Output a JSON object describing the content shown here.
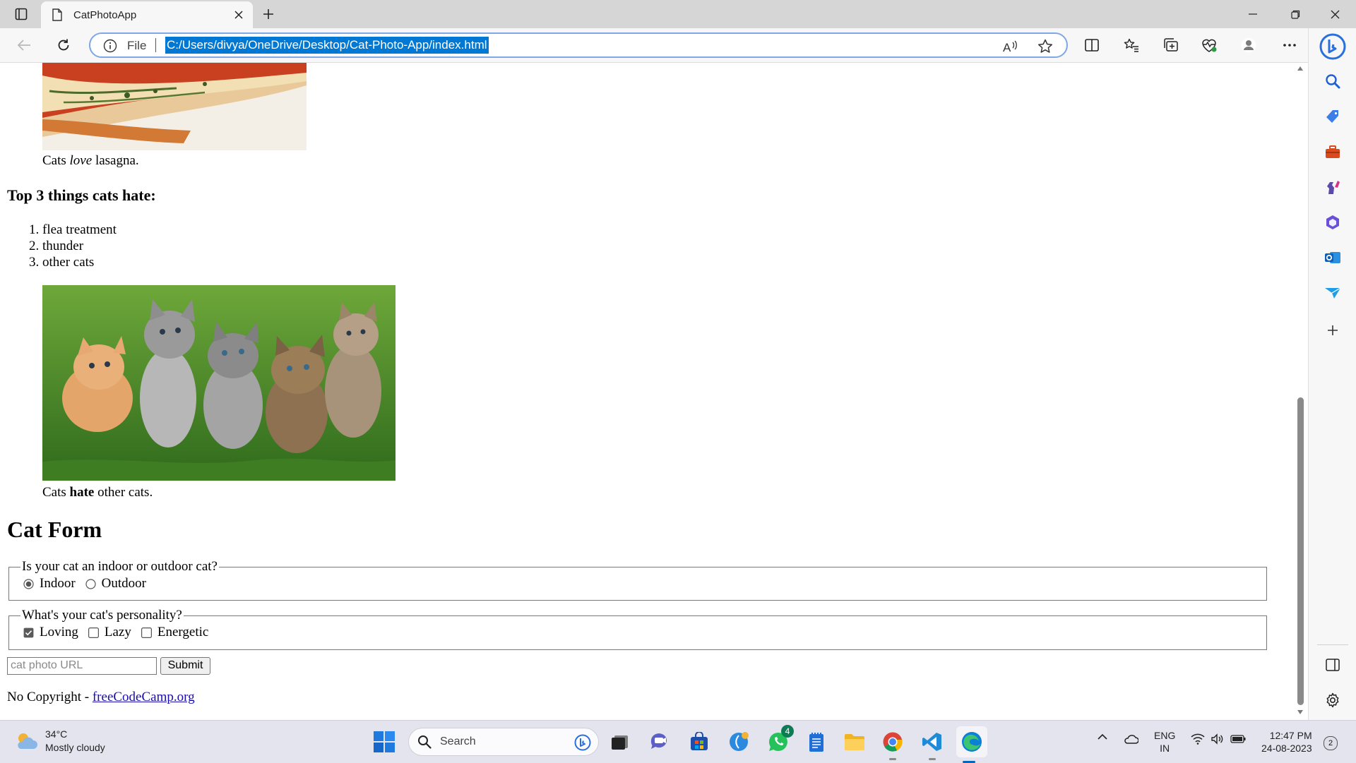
{
  "browser": {
    "tab": {
      "title": "CatPhotoApp"
    },
    "address": {
      "scheme": "File",
      "url": "C:/Users/divya/OneDrive/Desktop/Cat-Photo-App/index.html"
    }
  },
  "page": {
    "caption_lasagna": {
      "before": "Cats ",
      "emphasis": "love",
      "after": " lasagna."
    },
    "hate_heading": "Top 3 things cats hate:",
    "hate_list": [
      "flea treatment",
      "thunder",
      "other cats"
    ],
    "caption_kittens": {
      "before": "Cats ",
      "strong": "hate",
      "after": " other cats."
    },
    "form_heading": "Cat Form",
    "indoor_outdoor": {
      "legend": "Is your cat an indoor or outdoor cat?",
      "options": [
        {
          "label": "Indoor",
          "checked": true
        },
        {
          "label": "Outdoor",
          "checked": false
        }
      ]
    },
    "personality": {
      "legend": "What's your cat's personality?",
      "options": [
        {
          "label": "Loving",
          "checked": true
        },
        {
          "label": "Lazy",
          "checked": false
        },
        {
          "label": "Energetic",
          "checked": false
        }
      ]
    },
    "url_input": {
      "placeholder": "cat photo URL",
      "value": ""
    },
    "submit_label": "Submit",
    "footer": {
      "text": "No Copyright - ",
      "link": "freeCodeCamp.org"
    }
  },
  "taskbar": {
    "weather": {
      "temp": "34°C",
      "condition": "Mostly cloudy"
    },
    "search_placeholder": "Search",
    "whatsapp_badge": "4",
    "language": {
      "line1": "ENG",
      "line2": "IN"
    },
    "clock": {
      "time": "12:47 PM",
      "date": "24-08-2023"
    },
    "notifications": "2"
  },
  "colors": {
    "accent": "#0078d4",
    "link": "#1a0dab",
    "tabstrip": "#d6d6d6"
  },
  "icons": {
    "sidebar": [
      "search-icon",
      "shopping-tag-icon",
      "toolbox-icon",
      "games-icon",
      "office-icon",
      "outlook-icon",
      "send-icon",
      "add-icon",
      "split-screen-icon",
      "settings-icon"
    ]
  }
}
